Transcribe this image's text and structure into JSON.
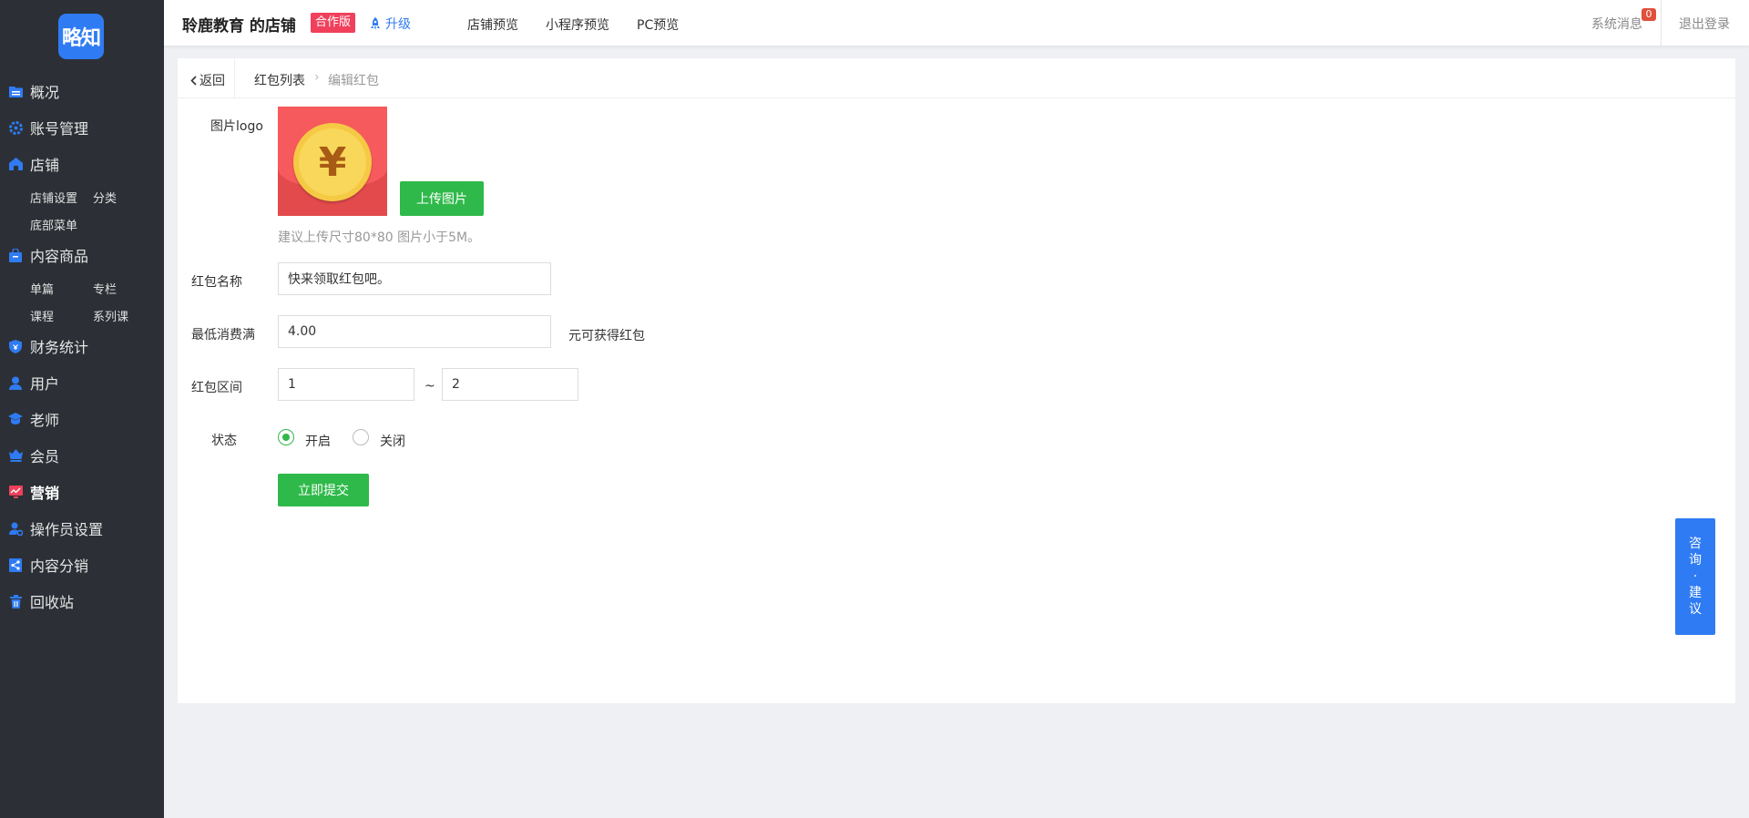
{
  "sidebar": {
    "logo_text": "略知",
    "items": [
      {
        "label": "概况",
        "icon": "folder-icon"
      },
      {
        "label": "账号管理",
        "icon": "gear-icon"
      },
      {
        "label": "店铺",
        "icon": "home-icon"
      },
      {
        "label": "内容商品",
        "icon": "bag-icon"
      },
      {
        "label": "财务统计",
        "icon": "shield-icon"
      },
      {
        "label": "用户",
        "icon": "user-icon"
      },
      {
        "label": "老师",
        "icon": "graduation-cap-icon"
      },
      {
        "label": "会员",
        "icon": "vip-icon"
      },
      {
        "label": "营销",
        "icon": "chart-icon"
      },
      {
        "label": "操作员设置",
        "icon": "user-gear-icon"
      },
      {
        "label": "内容分销",
        "icon": "share-icon"
      },
      {
        "label": "回收站",
        "icon": "trash-icon"
      }
    ],
    "shop_sub": [
      "店铺设置",
      "分类",
      "底部菜单"
    ],
    "content_sub": [
      "单篇",
      "专栏",
      "课程",
      "系列课"
    ]
  },
  "topbar": {
    "shop_name": "聆鹿教育 的店铺",
    "edition_badge": "合作版",
    "upgrade": "升级",
    "links": [
      "店铺预览",
      "小程序预览",
      "PC预览"
    ],
    "system_message": "系统消息",
    "message_count": "0",
    "logout": "退出登录"
  },
  "breadcrumb": {
    "back": "返回",
    "list": "红包列表",
    "current": "编辑红包"
  },
  "form": {
    "logo_label": "图片logo",
    "upload_button": "上传图片",
    "upload_hint": "建议上传尺寸80*80 图片小于5M。",
    "name_label": "红包名称",
    "name_value": "快来领取红包吧。",
    "min_spend_label": "最低消费满",
    "min_spend_value": "4.00",
    "min_spend_suffix": "元可获得红包",
    "range_label": "红包区间",
    "range_min": "1",
    "range_sep": "~",
    "range_max": "2",
    "status_label": "状态",
    "status_on": "开启",
    "status_off": "关闭",
    "submit": "立即提交"
  },
  "consult_button": [
    "咨",
    "询",
    "·",
    "建",
    "议"
  ],
  "colors": {
    "sidebar_bg": "#2c3036",
    "accent_blue": "#2f7bf3",
    "accent_green": "#2fb94a",
    "badge_red": "#f0405b"
  }
}
